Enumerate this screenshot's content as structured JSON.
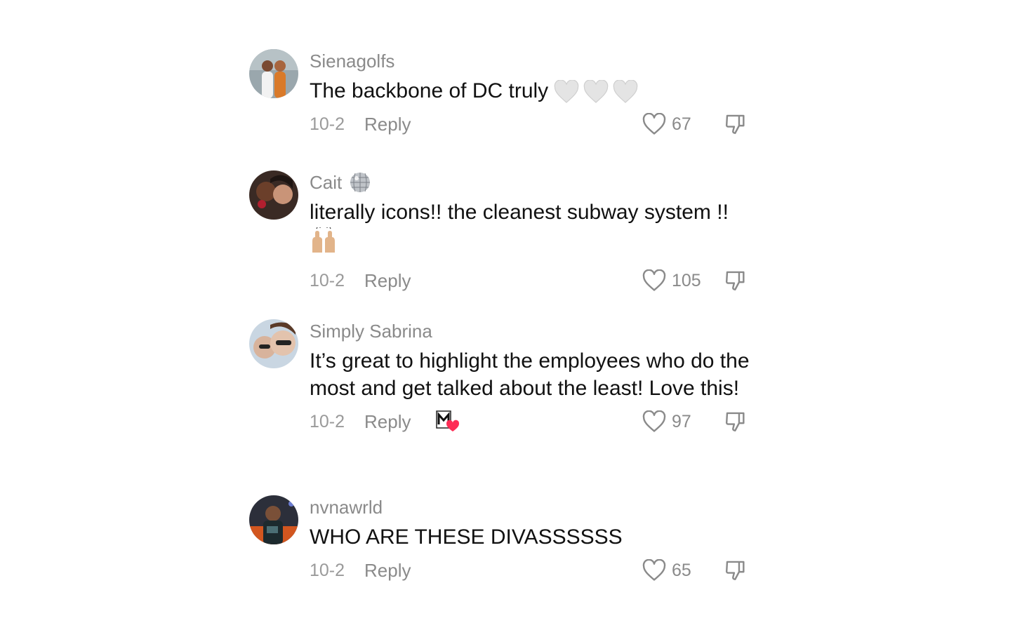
{
  "comments": [
    {
      "username": "Sienagolfs",
      "text": "The backbone of DC truly",
      "text_emojis": "white-heart x3",
      "date": "10-2",
      "reply_label": "Reply",
      "likes": "67"
    },
    {
      "username": "Cait",
      "username_emoji": "disco-ball",
      "text": "literally icons!! the cleanest subway system !!",
      "text_emojis": "raising-hands",
      "date": "10-2",
      "reply_label": "Reply",
      "likes": "105"
    },
    {
      "username": "Simply Sabrina",
      "text": "It’s great to highlight the employees who do the most and get talked about the least! Love this!",
      "date": "10-2",
      "reply_label": "Reply",
      "creator_liked_badge": "creator-liked-badge",
      "likes": "97"
    },
    {
      "username": "nvnawrld",
      "text": "WHO ARE THESE DIVASSSSSS",
      "date": "10-2",
      "reply_label": "Reply",
      "likes": "65"
    }
  ],
  "colors": {
    "username": "#8a8a8a",
    "text": "#111111",
    "meta": "#9a9a9a",
    "like_badge": "#fe2c55"
  }
}
